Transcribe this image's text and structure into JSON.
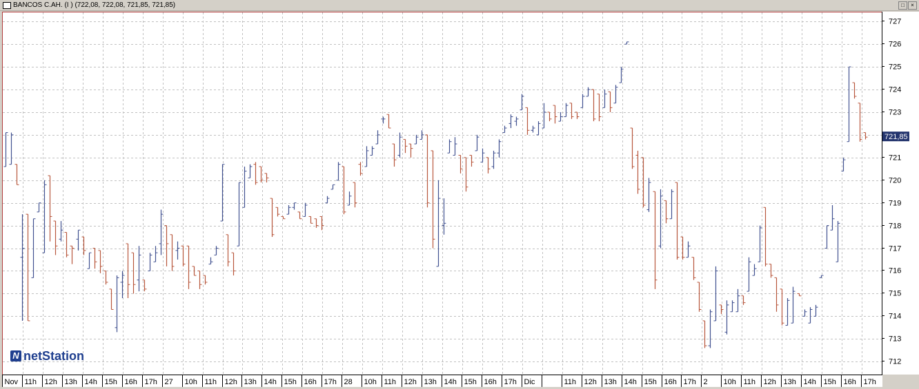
{
  "window": {
    "title": "BANCOS C.AH. (I ) (722,08, 722,08, 721,85, 721,85)",
    "buttons": [
      "restore",
      "close"
    ]
  },
  "logo": {
    "text": "netStation",
    "mark": "N"
  },
  "price_label": "721,85",
  "chart_data": {
    "type": "ohlc",
    "title": "BANCOS C.AH. (I )",
    "ohlc_last": [
      "722,08",
      "722,08",
      "721,85",
      "721,85"
    ],
    "ylim": [
      711.4,
      727.4
    ],
    "yticks": [
      712,
      713,
      714,
      715,
      716,
      717,
      718,
      719,
      720,
      721,
      722,
      723,
      724,
      725,
      726,
      727
    ],
    "grid": true,
    "colors": {
      "up": "#3f4f8f",
      "down": "#b7553a",
      "grid": "#c0c0c0",
      "frame": "#b23a3a",
      "price_label_bg": "#24356e"
    },
    "xlabels": [
      "Nov",
      "11h",
      "12h",
      "13h",
      "14h",
      "15h",
      "16h",
      "17h",
      "27",
      "10h",
      "11h",
      "12h",
      "13h",
      "14h",
      "15h",
      "16h",
      "17h",
      "28",
      "10h",
      "11h",
      "12h",
      "13h",
      "14h",
      "15h",
      "16h",
      "17h",
      "Dic",
      "",
      "11h",
      "12h",
      "13h",
      "14h",
      "15h",
      "16h",
      "17h",
      "2",
      "10h",
      "11h",
      "12h",
      "13h",
      "14h",
      "15h",
      "16h",
      "17h"
    ],
    "bars": [
      {
        "h": 722.1,
        "l": 720.6,
        "o": 720.6,
        "c": 722.1
      },
      {
        "h": 722.1,
        "l": 720.7,
        "o": 720.7,
        "c": 722.0
      },
      {
        "h": 720.7,
        "l": 719.8,
        "o": 720.7,
        "c": 719.8
      },
      {
        "h": 718.5,
        "l": 713.8,
        "o": 716.6,
        "c": 717.0
      },
      {
        "h": 718.5,
        "l": 713.8,
        "o": 718.5,
        "c": 713.8
      },
      {
        "h": 718.3,
        "l": 715.7,
        "o": 715.7,
        "c": 718.3
      },
      {
        "h": 719.0,
        "l": 718.6,
        "o": 718.6,
        "c": 719.0
      },
      {
        "h": 720.0,
        "l": 716.8,
        "o": 716.8,
        "c": 719.8
      },
      {
        "h": 720.2,
        "l": 717.3,
        "o": 720.2,
        "c": 718.4
      },
      {
        "h": 718.2,
        "l": 716.7,
        "o": 718.2,
        "c": 717.1
      },
      {
        "h": 718.2,
        "l": 717.3,
        "o": 717.4,
        "c": 717.8
      },
      {
        "h": 717.7,
        "l": 716.6,
        "o": 717.7,
        "c": 716.7
      },
      {
        "h": 717.1,
        "l": 716.3,
        "o": 717.1,
        "c": 717.0
      },
      {
        "h": 717.8,
        "l": 716.9,
        "o": 717.4,
        "c": 717.8
      },
      {
        "h": 717.5,
        "l": 716.7,
        "o": 717.5,
        "c": 716.9
      },
      {
        "h": 716.8,
        "l": 716.1,
        "o": 716.1,
        "c": 716.8
      },
      {
        "h": 717.0,
        "l": 716.1,
        "o": 717.0,
        "c": 716.4
      },
      {
        "h": 716.9,
        "l": 715.9,
        "o": 716.9,
        "c": 716.2
      },
      {
        "h": 716.0,
        "l": 715.4,
        "o": 716.0,
        "c": 715.5
      },
      {
        "h": 715.2,
        "l": 714.3,
        "o": 715.2,
        "c": 714.3
      },
      {
        "h": 715.8,
        "l": 713.3,
        "o": 713.5,
        "c": 715.7
      },
      {
        "h": 716.0,
        "l": 714.8,
        "o": 715.5,
        "c": 715.8
      },
      {
        "h": 717.2,
        "l": 714.8,
        "o": 717.2,
        "c": 715.4
      },
      {
        "h": 716.8,
        "l": 715.0,
        "o": 716.8,
        "c": 715.4
      },
      {
        "h": 717.1,
        "l": 715.1,
        "o": 715.6,
        "c": 716.7
      },
      {
        "h": 715.6,
        "l": 715.1,
        "o": 715.6,
        "c": 715.2
      },
      {
        "h": 716.8,
        "l": 716.0,
        "o": 716.0,
        "c": 716.7
      },
      {
        "h": 717.1,
        "l": 716.4,
        "o": 716.4,
        "c": 716.8
      },
      {
        "h": 718.7,
        "l": 716.7,
        "o": 717.2,
        "c": 718.5
      },
      {
        "h": 718.0,
        "l": 716.2,
        "o": 718.0,
        "c": 717.2
      },
      {
        "h": 717.6,
        "l": 716.0,
        "o": 717.6,
        "c": 716.2
      },
      {
        "h": 717.3,
        "l": 716.5,
        "o": 716.9,
        "c": 717.0
      },
      {
        "h": 717.1,
        "l": 716.2,
        "o": 717.1,
        "c": 716.3
      },
      {
        "h": 717.1,
        "l": 715.2,
        "o": 717.1,
        "c": 715.5
      },
      {
        "h": 716.2,
        "l": 715.8,
        "o": 716.2,
        "c": 715.8
      },
      {
        "h": 716.0,
        "l": 715.2,
        "o": 716.0,
        "c": 715.4
      },
      {
        "h": 715.8,
        "l": 715.4,
        "o": 715.8,
        "c": 715.5
      },
      {
        "h": 716.6,
        "l": 716.3,
        "o": 716.3,
        "c": 716.4
      },
      {
        "h": 717.1,
        "l": 716.7,
        "o": 716.7,
        "c": 717.0
      },
      {
        "h": 720.7,
        "l": 718.2,
        "o": 718.2,
        "c": 720.7
      },
      {
        "h": 717.6,
        "l": 716.2,
        "o": 717.6,
        "c": 716.4
      },
      {
        "h": 716.8,
        "l": 715.8,
        "o": 716.8,
        "c": 716.0
      },
      {
        "h": 719.9,
        "l": 717.1,
        "o": 717.1,
        "c": 719.9
      },
      {
        "h": 720.6,
        "l": 718.8,
        "o": 718.8,
        "c": 720.4
      },
      {
        "h": 720.7,
        "l": 720.1,
        "o": 720.1,
        "c": 720.6
      },
      {
        "h": 720.8,
        "l": 719.8,
        "o": 720.7,
        "c": 719.9
      },
      {
        "h": 720.6,
        "l": 719.9,
        "o": 720.6,
        "c": 720.0
      },
      {
        "h": 720.3,
        "l": 719.9,
        "o": 720.3,
        "c": 720.1
      },
      {
        "h": 719.2,
        "l": 717.5,
        "o": 719.2,
        "c": 717.6
      },
      {
        "h": 718.8,
        "l": 718.4,
        "o": 718.8,
        "c": 718.5
      },
      {
        "h": 718.4,
        "l": 718.3,
        "o": 718.4,
        "c": 718.3
      },
      {
        "h": 718.9,
        "l": 718.5,
        "o": 718.5,
        "c": 718.8
      },
      {
        "h": 719.0,
        "l": 718.7,
        "o": 718.8,
        "c": 719.0
      },
      {
        "h": 718.6,
        "l": 718.3,
        "o": 718.6,
        "c": 718.3
      },
      {
        "h": 719.0,
        "l": 718.4,
        "o": 718.4,
        "c": 718.9
      },
      {
        "h": 718.4,
        "l": 718.1,
        "o": 718.4,
        "c": 718.1
      },
      {
        "h": 718.3,
        "l": 717.9,
        "o": 718.3,
        "c": 718.0
      },
      {
        "h": 718.4,
        "l": 717.8,
        "o": 718.4,
        "c": 718.0
      },
      {
        "h": 719.3,
        "l": 719.0,
        "o": 719.0,
        "c": 719.2
      },
      {
        "h": 719.8,
        "l": 719.6,
        "o": 719.6,
        "c": 719.8
      },
      {
        "h": 720.8,
        "l": 720.0,
        "o": 720.0,
        "c": 720.7
      },
      {
        "h": 720.6,
        "l": 718.5,
        "o": 720.6,
        "c": 718.6
      },
      {
        "h": 719.5,
        "l": 718.9,
        "o": 718.9,
        "c": 719.3
      },
      {
        "h": 719.9,
        "l": 718.8,
        "o": 719.9,
        "c": 719.0
      },
      {
        "h": 720.8,
        "l": 720.2,
        "o": 720.7,
        "c": 720.3
      },
      {
        "h": 721.5,
        "l": 720.6,
        "o": 720.6,
        "c": 721.3
      },
      {
        "h": 721.5,
        "l": 721.1,
        "o": 721.1,
        "c": 721.4
      },
      {
        "h": 722.2,
        "l": 721.6,
        "o": 721.6,
        "c": 722.0
      },
      {
        "h": 722.8,
        "l": 722.5,
        "o": 722.7,
        "c": 722.7
      },
      {
        "h": 722.9,
        "l": 722.3,
        "o": 722.9,
        "c": 722.3
      },
      {
        "h": 721.6,
        "l": 720.6,
        "o": 721.6,
        "c": 720.9
      },
      {
        "h": 722.1,
        "l": 721.0,
        "o": 721.1,
        "c": 721.9
      },
      {
        "h": 721.8,
        "l": 721.2,
        "o": 721.8,
        "c": 721.5
      },
      {
        "h": 721.6,
        "l": 721.0,
        "o": 721.6,
        "c": 721.4
      },
      {
        "h": 722.0,
        "l": 721.6,
        "o": 721.6,
        "c": 721.9
      },
      {
        "h": 722.2,
        "l": 721.8,
        "o": 721.8,
        "c": 722.0
      },
      {
        "h": 722.0,
        "l": 718.8,
        "o": 722.0,
        "c": 719.0
      },
      {
        "h": 721.3,
        "l": 717.0,
        "o": 721.3,
        "c": 717.4
      },
      {
        "h": 720.0,
        "l": 716.2,
        "o": 716.2,
        "c": 719.2
      },
      {
        "h": 719.2,
        "l": 717.6,
        "o": 718.0,
        "c": 718.1
      },
      {
        "h": 721.8,
        "l": 721.2,
        "o": 721.2,
        "c": 721.7
      },
      {
        "h": 721.9,
        "l": 721.1,
        "o": 721.1,
        "c": 721.6
      },
      {
        "h": 721.1,
        "l": 720.3,
        "o": 721.1,
        "c": 720.5
      },
      {
        "h": 721.0,
        "l": 719.5,
        "o": 721.0,
        "c": 719.7
      },
      {
        "h": 721.1,
        "l": 720.6,
        "o": 721.1,
        "c": 720.8
      },
      {
        "h": 722.0,
        "l": 721.3,
        "o": 721.3,
        "c": 721.9
      },
      {
        "h": 721.4,
        "l": 720.8,
        "o": 720.8,
        "c": 721.2
      },
      {
        "h": 721.0,
        "l": 720.3,
        "o": 721.0,
        "c": 720.5
      },
      {
        "h": 721.3,
        "l": 720.5,
        "o": 720.6,
        "c": 721.2
      },
      {
        "h": 721.8,
        "l": 721.0,
        "o": 721.2,
        "c": 721.7
      },
      {
        "h": 722.4,
        "l": 722.1,
        "o": 722.1,
        "c": 722.3
      },
      {
        "h": 722.9,
        "l": 722.3,
        "o": 722.5,
        "c": 722.8
      },
      {
        "h": 722.8,
        "l": 722.4,
        "o": 722.6,
        "c": 722.7
      },
      {
        "h": 723.8,
        "l": 723.1,
        "o": 723.1,
        "c": 723.7
      },
      {
        "h": 723.2,
        "l": 722.0,
        "o": 723.2,
        "c": 722.2
      },
      {
        "h": 722.4,
        "l": 722.1,
        "o": 722.2,
        "c": 722.3
      },
      {
        "h": 722.6,
        "l": 722.0,
        "o": 722.0,
        "c": 722.5
      },
      {
        "h": 723.4,
        "l": 722.3,
        "o": 722.3,
        "c": 723.0
      },
      {
        "h": 723.0,
        "l": 722.6,
        "o": 723.0,
        "c": 722.7
      },
      {
        "h": 723.3,
        "l": 722.5,
        "o": 723.3,
        "c": 722.8
      },
      {
        "h": 723.0,
        "l": 722.6,
        "o": 722.6,
        "c": 722.8
      },
      {
        "h": 723.4,
        "l": 722.8,
        "o": 722.8,
        "c": 723.3
      },
      {
        "h": 723.4,
        "l": 722.7,
        "o": 723.4,
        "c": 722.8
      },
      {
        "h": 723.0,
        "l": 722.7,
        "o": 723.0,
        "c": 722.8
      },
      {
        "h": 723.8,
        "l": 723.2,
        "o": 723.2,
        "c": 723.7
      },
      {
        "h": 724.1,
        "l": 723.7,
        "o": 723.7,
        "c": 724.0
      },
      {
        "h": 724.0,
        "l": 722.6,
        "o": 724.0,
        "c": 722.7
      },
      {
        "h": 723.8,
        "l": 722.6,
        "o": 723.8,
        "c": 722.8
      },
      {
        "h": 724.0,
        "l": 723.2,
        "o": 723.2,
        "c": 723.8
      },
      {
        "h": 723.9,
        "l": 723.0,
        "o": 723.9,
        "c": 723.2
      },
      {
        "h": 724.2,
        "l": 723.4,
        "o": 723.4,
        "c": 724.1
      },
      {
        "h": 725.0,
        "l": 724.3,
        "o": 724.3,
        "c": 724.9
      },
      {
        "h": 726.1,
        "l": 726.0,
        "o": 726.0,
        "c": 726.1
      },
      {
        "h": 722.3,
        "l": 720.5,
        "o": 722.3,
        "c": 720.6
      },
      {
        "h": 721.3,
        "l": 719.4,
        "o": 721.1,
        "c": 719.6
      },
      {
        "h": 721.0,
        "l": 718.8,
        "o": 721.0,
        "c": 718.9
      },
      {
        "h": 720.1,
        "l": 718.6,
        "o": 718.7,
        "c": 719.9
      },
      {
        "h": 719.5,
        "l": 715.2,
        "o": 719.5,
        "c": 715.6
      },
      {
        "h": 719.6,
        "l": 717.0,
        "o": 717.1,
        "c": 719.3
      },
      {
        "h": 719.1,
        "l": 718.1,
        "o": 719.1,
        "c": 718.3
      },
      {
        "h": 719.6,
        "l": 718.3,
        "o": 718.3,
        "c": 719.5
      },
      {
        "h": 719.9,
        "l": 716.5,
        "o": 719.9,
        "c": 716.6
      },
      {
        "h": 717.5,
        "l": 716.5,
        "o": 717.5,
        "c": 716.6
      },
      {
        "h": 717.3,
        "l": 716.6,
        "o": 716.6,
        "c": 717.1
      },
      {
        "h": 716.6,
        "l": 715.6,
        "o": 716.6,
        "c": 715.7
      },
      {
        "h": 715.5,
        "l": 714.2,
        "o": 715.5,
        "c": 714.3
      },
      {
        "h": 713.8,
        "l": 712.6,
        "o": 713.8,
        "c": 712.7
      },
      {
        "h": 714.3,
        "l": 712.6,
        "o": 712.7,
        "c": 714.2
      },
      {
        "h": 716.2,
        "l": 713.8,
        "o": 713.8,
        "c": 716.0
      },
      {
        "h": 714.5,
        "l": 714.1,
        "o": 714.5,
        "c": 714.3
      },
      {
        "h": 714.7,
        "l": 713.2,
        "o": 713.3,
        "c": 714.5
      },
      {
        "h": 714.7,
        "l": 714.2,
        "o": 714.2,
        "c": 714.6
      },
      {
        "h": 715.2,
        "l": 714.2,
        "o": 714.2,
        "c": 714.9
      },
      {
        "h": 714.9,
        "l": 714.5,
        "o": 714.9,
        "c": 714.6
      },
      {
        "h": 716.6,
        "l": 715.1,
        "o": 715.1,
        "c": 716.4
      },
      {
        "h": 716.3,
        "l": 715.8,
        "o": 715.8,
        "c": 716.1
      },
      {
        "h": 718.0,
        "l": 716.4,
        "o": 716.4,
        "c": 717.9
      },
      {
        "h": 718.8,
        "l": 716.2,
        "o": 718.8,
        "c": 716.3
      },
      {
        "h": 716.3,
        "l": 715.7,
        "o": 716.3,
        "c": 715.8
      },
      {
        "h": 715.7,
        "l": 714.2,
        "o": 715.7,
        "c": 714.5
      },
      {
        "h": 715.2,
        "l": 713.6,
        "o": 715.2,
        "c": 713.7
      },
      {
        "h": 714.8,
        "l": 713.6,
        "o": 713.6,
        "c": 714.7
      },
      {
        "h": 715.3,
        "l": 713.7,
        "o": 713.7,
        "c": 715.1
      },
      {
        "h": 715.0,
        "l": 714.9,
        "o": 715.0,
        "c": 714.9
      },
      {
        "h": 714.3,
        "l": 714.0,
        "o": 714.0,
        "c": 714.2
      },
      {
        "h": 714.4,
        "l": 713.7,
        "o": 713.7,
        "c": 714.3
      },
      {
        "h": 714.5,
        "l": 714.0,
        "o": 714.0,
        "c": 714.4
      },
      {
        "h": 715.8,
        "l": 715.7,
        "o": 715.7,
        "c": 715.8
      },
      {
        "h": 718.0,
        "l": 717.0,
        "o": 717.0,
        "c": 718.0
      },
      {
        "h": 718.9,
        "l": 717.8,
        "o": 717.8,
        "c": 718.3
      },
      {
        "h": 718.2,
        "l": 716.4,
        "o": 716.4,
        "c": 718.1
      },
      {
        "h": 721.0,
        "l": 720.4,
        "o": 720.4,
        "c": 720.9
      },
      {
        "h": 725.0,
        "l": 721.7,
        "o": 721.7,
        "c": 725.0
      },
      {
        "h": 724.3,
        "l": 723.6,
        "o": 724.3,
        "c": 723.7
      },
      {
        "h": 723.4,
        "l": 721.7,
        "o": 723.4,
        "c": 721.8
      },
      {
        "h": 722.1,
        "l": 721.8,
        "o": 722.1,
        "c": 721.9
      }
    ]
  }
}
